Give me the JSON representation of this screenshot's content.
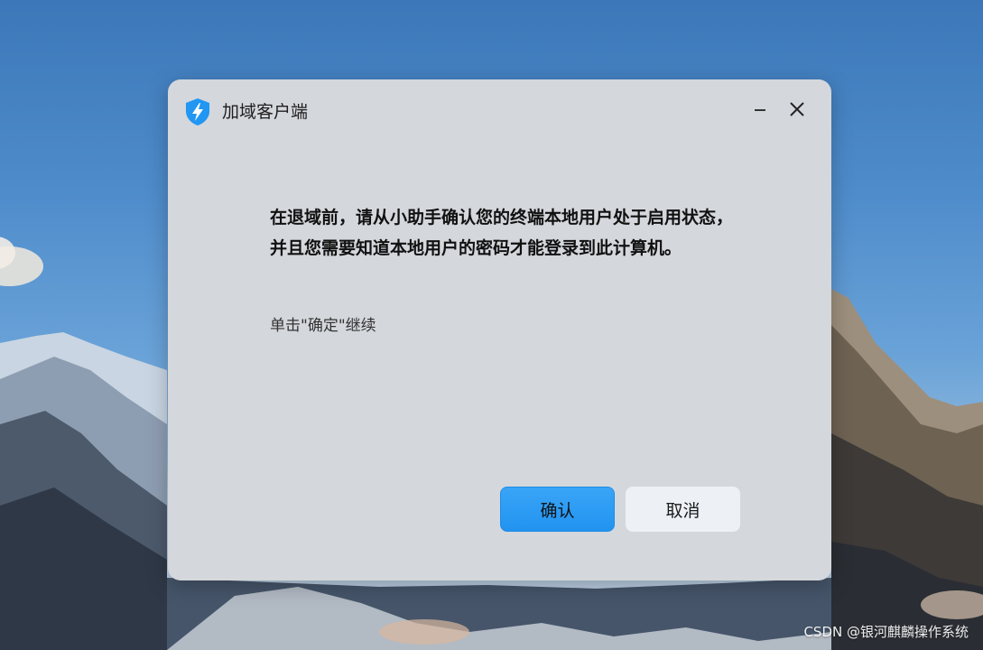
{
  "window": {
    "title": "加域客户端",
    "icon": "shield-lightning-icon",
    "minimize_icon": "minimize-icon",
    "close_icon": "close-icon"
  },
  "dialog": {
    "message": "在退域前，请从小助手确认您的终端本地用户处于启用状态，并且您需要知道本地用户的密码才能登录到此计算机。",
    "hint": "单击\"确定\"继续"
  },
  "buttons": {
    "confirm_label": "确认",
    "cancel_label": "取消"
  },
  "watermark": "CSDN @银河麒麟操作系统",
  "colors": {
    "accent": "#2196f3",
    "dialog_bg": "#d4d7dc",
    "cancel_bg": "#edf1f6"
  }
}
